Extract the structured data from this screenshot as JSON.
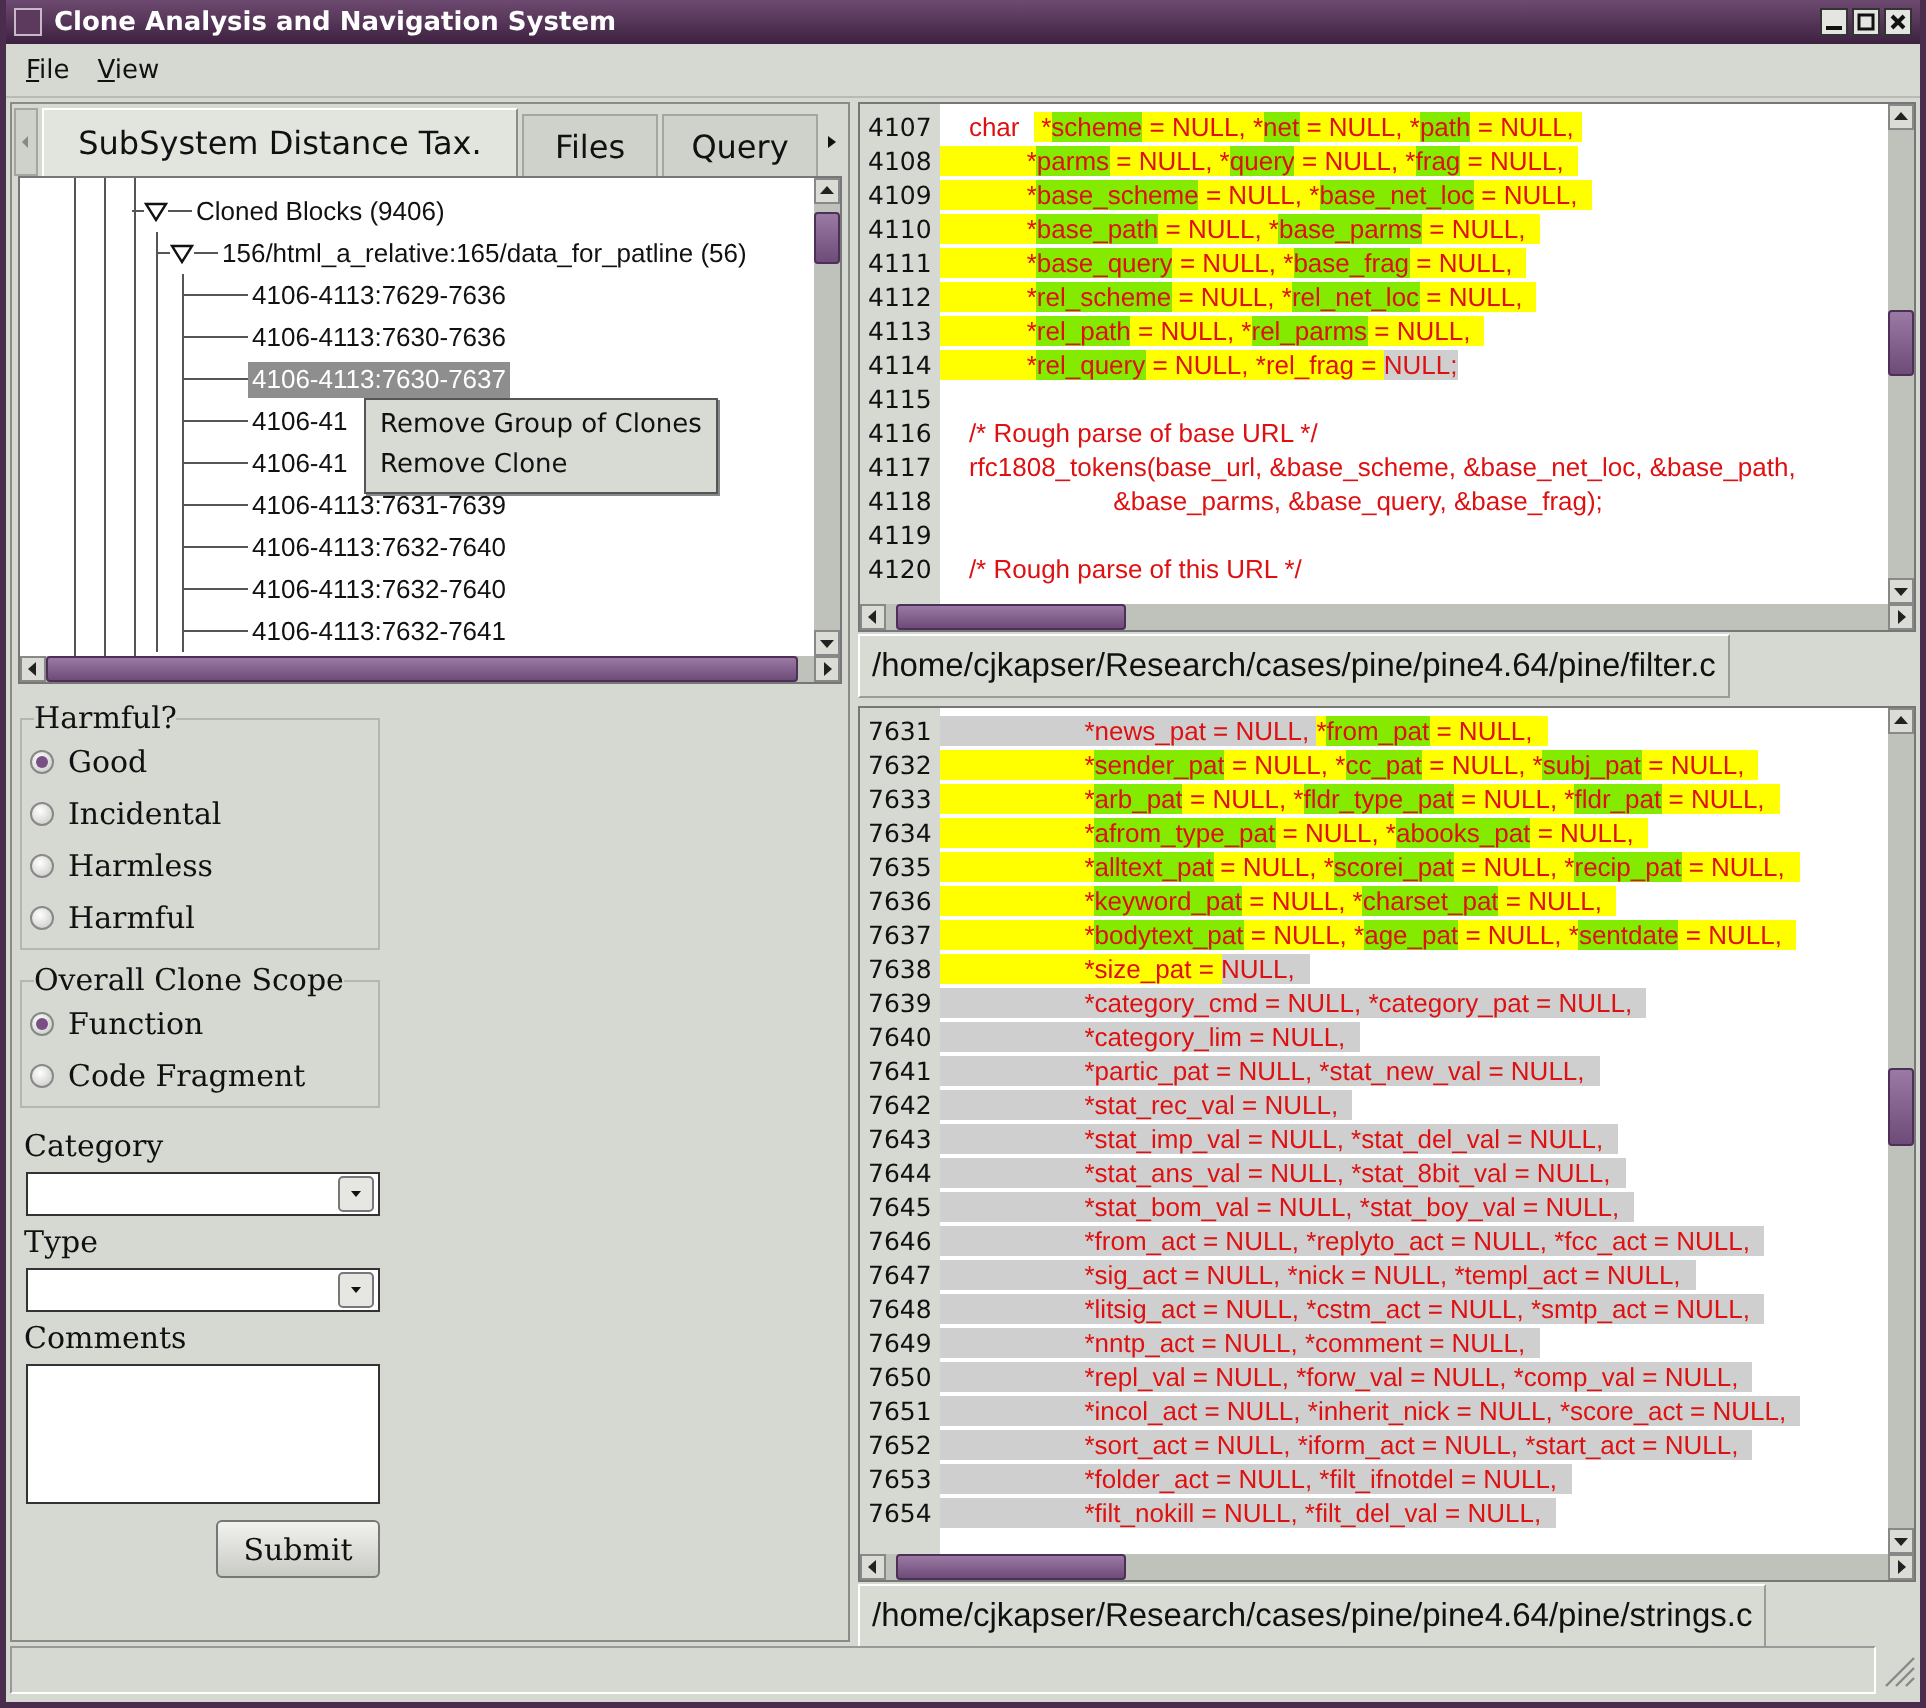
{
  "window": {
    "title": "Clone Analysis and Navigation System"
  },
  "menu_bar": [
    "File",
    "View"
  ],
  "tabs": [
    {
      "label": "SubSystem Distance Tax.",
      "selected": true
    },
    {
      "label": "Files",
      "selected": false
    },
    {
      "label": "Query",
      "selected": false
    }
  ],
  "tree": {
    "items": [
      {
        "label": "Cloned Blocks (9406)",
        "expanded": true,
        "selected": false,
        "children": [
          {
            "label": "156/html_a_relative:165/data_for_patline (56)",
            "expanded": true,
            "selected": false,
            "children": [
              {
                "label": "4106-4113:7629-7636",
                "selected": false
              },
              {
                "label": "4106-4113:7630-7636",
                "selected": false
              },
              {
                "label": "4106-4113:7630-7637",
                "selected": true
              },
              {
                "label": "4106-41",
                "selected": false
              },
              {
                "label": "4106-41",
                "selected": false
              },
              {
                "label": "4106-4113:7631-7639",
                "selected": false
              },
              {
                "label": "4106-4113:7632-7640",
                "selected": false
              },
              {
                "label": "4106-4113:7632-7640",
                "selected": false
              },
              {
                "label": "4106-4113:7632-7641",
                "selected": false
              }
            ]
          }
        ]
      }
    ]
  },
  "context_menu": {
    "items": [
      "Remove Group of Clones",
      "Remove Clone"
    ]
  },
  "form": {
    "harmful": {
      "title": "Harmful?",
      "options": [
        {
          "label": "Good",
          "selected": true
        },
        {
          "label": "Incidental",
          "selected": false
        },
        {
          "label": "Harmless",
          "selected": false
        },
        {
          "label": "Harmful",
          "selected": false
        }
      ]
    },
    "scope": {
      "title": "Overall Clone Scope",
      "options": [
        {
          "label": "Function",
          "selected": true
        },
        {
          "label": "Code Fragment",
          "selected": false
        }
      ]
    },
    "category": {
      "label": "Category"
    },
    "type": {
      "label": "Type"
    },
    "comments": {
      "label": "Comments"
    },
    "submit": "Submit"
  },
  "code_panes": [
    {
      "file_path": "/home/cjkapser/Research/cases/pine/pine4.64/pine/filter.c",
      "lines": [
        {
          "number": "4107",
          "segments": [
            {
              "text": "    char  "
            },
            {
              "text": " *",
              "color": "#ffff00"
            },
            {
              "text": "scheme",
              "color": "#84ea00"
            },
            {
              "text": " = NULL, *",
              "color": "#ffff00"
            },
            {
              "text": "net",
              "color": "#84ea00"
            },
            {
              "text": " = NULL, *",
              "color": "#ffff00"
            },
            {
              "text": "path",
              "color": "#84ea00"
            },
            {
              "text": " = NULL, ",
              "color": "#ffff00"
            }
          ]
        },
        {
          "number": "4108",
          "segments": [
            {
              "text": "            *",
              "color": "#ffff00"
            },
            {
              "text": "parms",
              "color": "#84ea00"
            },
            {
              "text": " = NULL, *",
              "color": "#ffff00"
            },
            {
              "text": "query",
              "color": "#84ea00"
            },
            {
              "text": " = NULL, *",
              "color": "#ffff00"
            },
            {
              "text": "frag",
              "color": "#84ea00"
            },
            {
              "text": " = NULL,  ",
              "color": "#ffff00"
            }
          ]
        },
        {
          "number": "4109",
          "segments": [
            {
              "text": "            *",
              "color": "#ffff00"
            },
            {
              "text": "base_scheme",
              "color": "#84ea00"
            },
            {
              "text": " = NULL, *",
              "color": "#ffff00"
            },
            {
              "text": "base_net_loc",
              "color": "#84ea00"
            },
            {
              "text": " = NULL,  ",
              "color": "#ffff00"
            }
          ]
        },
        {
          "number": "4110",
          "segments": [
            {
              "text": "            *",
              "color": "#ffff00"
            },
            {
              "text": "base_path",
              "color": "#84ea00"
            },
            {
              "text": " = NULL, *",
              "color": "#ffff00"
            },
            {
              "text": "base_parms",
              "color": "#84ea00"
            },
            {
              "text": " = NULL,  ",
              "color": "#ffff00"
            }
          ]
        },
        {
          "number": "4111",
          "segments": [
            {
              "text": "            *",
              "color": "#ffff00"
            },
            {
              "text": "base_query",
              "color": "#84ea00"
            },
            {
              "text": " = NULL, *",
              "color": "#ffff00"
            },
            {
              "text": "base_frag",
              "color": "#84ea00"
            },
            {
              "text": " = NULL,  ",
              "color": "#ffff00"
            }
          ]
        },
        {
          "number": "4112",
          "segments": [
            {
              "text": "            *",
              "color": "#ffff00"
            },
            {
              "text": "rel_scheme",
              "color": "#84ea00"
            },
            {
              "text": " = NULL, *",
              "color": "#ffff00"
            },
            {
              "text": "rel_net_loc",
              "color": "#84ea00"
            },
            {
              "text": " = NULL,  ",
              "color": "#ffff00"
            }
          ]
        },
        {
          "number": "4113",
          "segments": [
            {
              "text": "            *",
              "color": "#ffff00"
            },
            {
              "text": "rel_path",
              "color": "#84ea00"
            },
            {
              "text": " = NULL, *",
              "color": "#ffff00"
            },
            {
              "text": "rel_parms",
              "color": "#84ea00"
            },
            {
              "text": " = NULL,  ",
              "color": "#ffff00"
            }
          ]
        },
        {
          "number": "4114",
          "segments": [
            {
              "text": "            *",
              "color": "#ffff00"
            },
            {
              "text": "rel_query",
              "color": "#84ea00"
            },
            {
              "text": " = NULL, *rel_frag = ",
              "color": "#ffff00"
            },
            {
              "text": "NULL;",
              "color": "#cfcfcf"
            }
          ]
        },
        {
          "number": "4115"
        },
        {
          "number": "4116",
          "segments": [
            {
              "text": "    /* Rough parse of base URL */"
            }
          ]
        },
        {
          "number": "4117",
          "segments": [
            {
              "text": "    rfc1808_tokens(base_url, &base_scheme, &base_net_loc, &base_path,"
            }
          ]
        },
        {
          "number": "4118",
          "segments": [
            {
              "text": "                        &base_parms, &base_query, &base_frag);"
            }
          ]
        },
        {
          "number": "4119"
        },
        {
          "number": "4120",
          "segments": [
            {
              "text": "    /* Rough parse of this URL */"
            }
          ]
        }
      ]
    },
    {
      "file_path": "/home/cjkapser/Research/cases/pine/pine4.64/pine/strings.c",
      "lines": [
        {
          "number": "7631",
          "segments": [
            {
              "text": "                    *news_pat = NULL, ",
              "color": "#cfcfcf"
            },
            {
              "text": "*",
              "color": "#ffff00"
            },
            {
              "text": "from_pat",
              "color": "#84ea00"
            },
            {
              "text": " = NULL,  ",
              "color": "#ffff00"
            }
          ]
        },
        {
          "number": "7632",
          "segments": [
            {
              "text": "                    *",
              "color": "#ffff00"
            },
            {
              "text": "sender_pat",
              "color": "#84ea00"
            },
            {
              "text": " = NULL, *",
              "color": "#ffff00"
            },
            {
              "text": "cc_pat",
              "color": "#84ea00"
            },
            {
              "text": " = NULL, *",
              "color": "#ffff00"
            },
            {
              "text": "subj_pat",
              "color": "#84ea00"
            },
            {
              "text": " = NULL,  ",
              "color": "#ffff00"
            }
          ]
        },
        {
          "number": "7633",
          "segments": [
            {
              "text": "                    *",
              "color": "#ffff00"
            },
            {
              "text": "arb_pat",
              "color": "#84ea00"
            },
            {
              "text": " = NULL, *",
              "color": "#ffff00"
            },
            {
              "text": "fldr_type_pat",
              "color": "#84ea00"
            },
            {
              "text": " = NULL, *",
              "color": "#ffff00"
            },
            {
              "text": "fldr_pat",
              "color": "#84ea00"
            },
            {
              "text": " = NULL,  ",
              "color": "#ffff00"
            }
          ]
        },
        {
          "number": "7634",
          "segments": [
            {
              "text": "                    *",
              "color": "#ffff00"
            },
            {
              "text": "afrom_type_pat",
              "color": "#84ea00"
            },
            {
              "text": " = NULL, *",
              "color": "#ffff00"
            },
            {
              "text": "abooks_pat",
              "color": "#84ea00"
            },
            {
              "text": " = NULL,  ",
              "color": "#ffff00"
            }
          ]
        },
        {
          "number": "7635",
          "segments": [
            {
              "text": "                    *",
              "color": "#ffff00"
            },
            {
              "text": "alltext_pat",
              "color": "#84ea00"
            },
            {
              "text": " = NULL, *",
              "color": "#ffff00"
            },
            {
              "text": "scorei_pat",
              "color": "#84ea00"
            },
            {
              "text": " = NULL, *",
              "color": "#ffff00"
            },
            {
              "text": "recip_pat",
              "color": "#84ea00"
            },
            {
              "text": " = NULL,  ",
              "color": "#ffff00"
            }
          ]
        },
        {
          "number": "7636",
          "segments": [
            {
              "text": "                    *",
              "color": "#ffff00"
            },
            {
              "text": "keyword_pat",
              "color": "#84ea00"
            },
            {
              "text": " = NULL, *",
              "color": "#ffff00"
            },
            {
              "text": "charset_pat",
              "color": "#84ea00"
            },
            {
              "text": " = NULL,  ",
              "color": "#ffff00"
            }
          ]
        },
        {
          "number": "7637",
          "segments": [
            {
              "text": "                    *",
              "color": "#ffff00"
            },
            {
              "text": "bodytext_pat",
              "color": "#84ea00"
            },
            {
              "text": " = NULL, *",
              "color": "#ffff00"
            },
            {
              "text": "age_pat",
              "color": "#84ea00"
            },
            {
              "text": " = NULL, *",
              "color": "#ffff00"
            },
            {
              "text": "sentdate",
              "color": "#84ea00"
            },
            {
              "text": " = NULL,  ",
              "color": "#ffff00"
            }
          ]
        },
        {
          "number": "7638",
          "segments": [
            {
              "text": "                    *size_pat = ",
              "color": "#ffff00"
            },
            {
              "text": "NULL,  ",
              "color": "#cfcfcf"
            }
          ]
        },
        {
          "number": "7639",
          "segments": [
            {
              "text": "                    *category_cmd = NULL, *category_pat = NULL,  ",
              "color": "#cfcfcf"
            }
          ]
        },
        {
          "number": "7640",
          "segments": [
            {
              "text": "                    *category_lim = NULL,  ",
              "color": "#cfcfcf"
            }
          ]
        },
        {
          "number": "7641",
          "segments": [
            {
              "text": "                    *partic_pat = NULL, *stat_new_val = NULL,  ",
              "color": "#cfcfcf"
            }
          ]
        },
        {
          "number": "7642",
          "segments": [
            {
              "text": "                    *stat_rec_val = NULL,  ",
              "color": "#cfcfcf"
            }
          ]
        },
        {
          "number": "7643",
          "segments": [
            {
              "text": "                    *stat_imp_val = NULL, *stat_del_val = NULL,  ",
              "color": "#cfcfcf"
            }
          ]
        },
        {
          "number": "7644",
          "segments": [
            {
              "text": "                    *stat_ans_val = NULL, *stat_8bit_val = NULL,  ",
              "color": "#cfcfcf"
            }
          ]
        },
        {
          "number": "7645",
          "segments": [
            {
              "text": "                    *stat_bom_val = NULL, *stat_boy_val = NULL,  ",
              "color": "#cfcfcf"
            }
          ]
        },
        {
          "number": "7646",
          "segments": [
            {
              "text": "                    *from_act = NULL, *replyto_act = NULL, *fcc_act = NULL,  ",
              "color": "#cfcfcf"
            }
          ]
        },
        {
          "number": "7647",
          "segments": [
            {
              "text": "                    *sig_act = NULL, *nick = NULL, *templ_act = NULL,  ",
              "color": "#cfcfcf"
            }
          ]
        },
        {
          "number": "7648",
          "segments": [
            {
              "text": "                    *litsig_act = NULL, *cstm_act = NULL, *smtp_act = NULL,  ",
              "color": "#cfcfcf"
            }
          ]
        },
        {
          "number": "7649",
          "segments": [
            {
              "text": "                    *nntp_act = NULL, *comment = NULL,  ",
              "color": "#cfcfcf"
            }
          ]
        },
        {
          "number": "7650",
          "segments": [
            {
              "text": "                    *repl_val = NULL, *forw_val = NULL, *comp_val = NULL,  ",
              "color": "#cfcfcf"
            }
          ]
        },
        {
          "number": "7651",
          "segments": [
            {
              "text": "                    *incol_act = NULL, *inherit_nick = NULL, *score_act = NULL,  ",
              "color": "#cfcfcf"
            }
          ]
        },
        {
          "number": "7652",
          "segments": [
            {
              "text": "                    *sort_act = NULL, *iform_act = NULL, *start_act = NULL,  ",
              "color": "#cfcfcf"
            }
          ]
        },
        {
          "number": "7653",
          "segments": [
            {
              "text": "                    *folder_act = NULL, *filt_ifnotdel = NULL,  ",
              "color": "#cfcfcf"
            }
          ]
        },
        {
          "number": "7654",
          "segments": [
            {
              "text": "                    *filt_nokill = NULL, *filt_del_val = NULL,  ",
              "color": "#cfcfcf"
            }
          ]
        }
      ]
    }
  ]
}
